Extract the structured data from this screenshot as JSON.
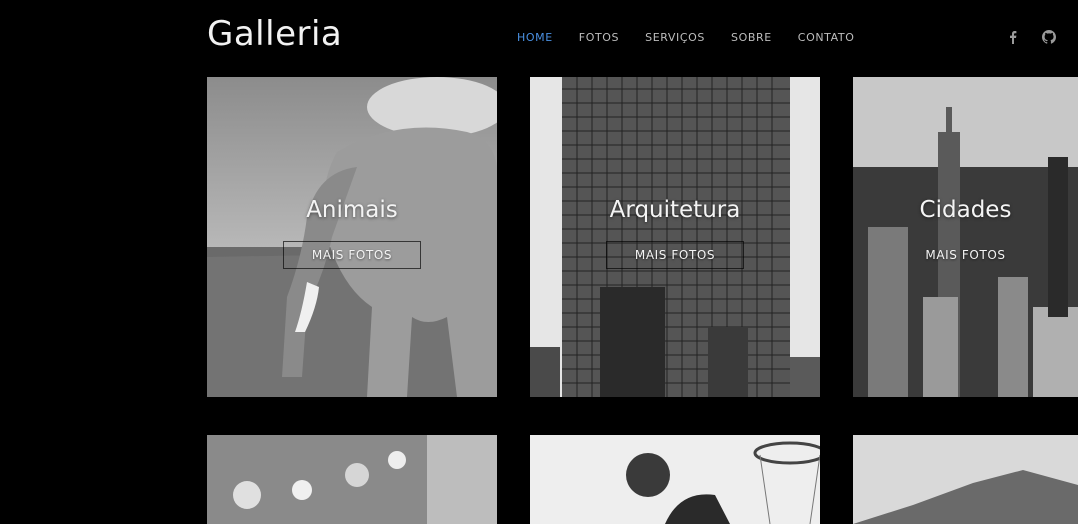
{
  "header": {
    "logo": "Galleria",
    "nav": [
      "HOME",
      "FOTOS",
      "SERVIÇOS",
      "SOBRE",
      "CONTATO"
    ],
    "active_nav": "HOME",
    "accent_color": "#4a90e2",
    "social_icons": [
      "facebook-icon",
      "github-icon"
    ]
  },
  "gallery": {
    "row1": [
      {
        "title": "Animais",
        "button": "MAIS FOTOS"
      },
      {
        "title": "Arquitetura",
        "button": "MAIS FOTOS"
      },
      {
        "title": "Cidades",
        "button": "MAIS FOTOS"
      }
    ]
  }
}
